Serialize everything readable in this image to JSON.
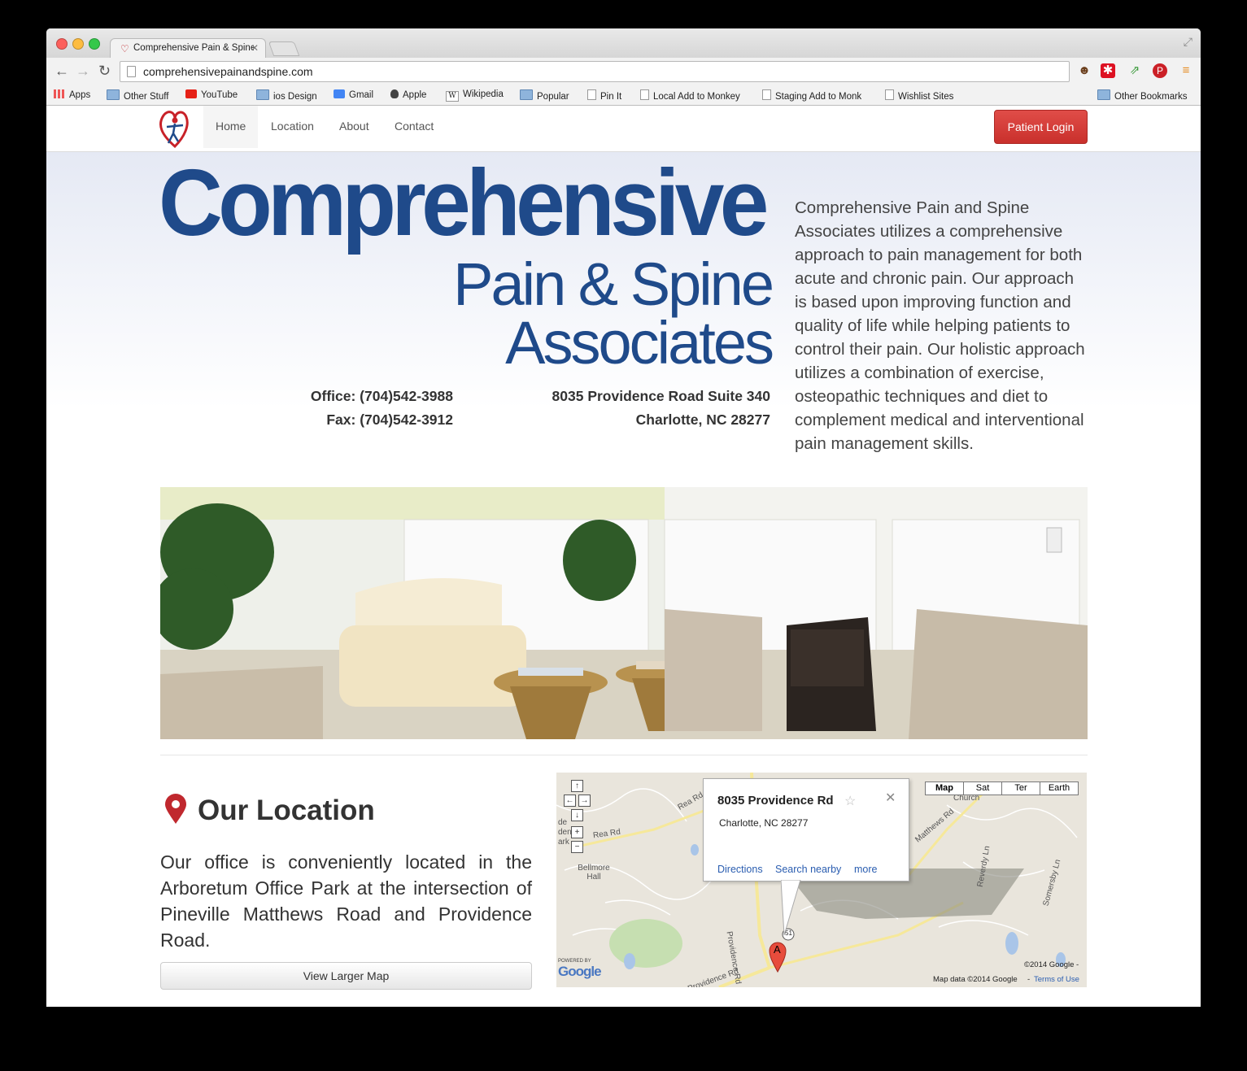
{
  "browser": {
    "tab_title": "Comprehensive Pain & Spine",
    "url": "comprehensivepainandspine.com",
    "bookmarks": [
      "Apps",
      "Other Stuff",
      "YouTube",
      "ios Design",
      "Gmail",
      "Apple",
      "Wikipedia",
      "Popular",
      "Pin It",
      "Local Add to Monkey",
      "Staging Add to Monk",
      "Wishlist Sites"
    ],
    "other_bookmarks": "Other Bookmarks"
  },
  "nav": {
    "links": [
      "Home",
      "Location",
      "About",
      "Contact"
    ],
    "login_label": "Patient Login"
  },
  "hero": {
    "brand_line1": "Comprehensive",
    "brand_line2": "Pain & Spine",
    "brand_line3": "Associates",
    "office": "Office: (704)542-3988",
    "fax": "Fax: (704)542-3912",
    "address1": "8035 Providence Road Suite 340",
    "address2": "Charlotte, NC 28277",
    "intro": "Comprehensive Pain and Spine Associates utilizes a comprehensive approach to pain management for both acute and chronic pain. Our approach is based upon improving function and quality of life while helping patients to control their pain. Our holistic approach utilizes a combination of exercise, osteopathic techniques and diet to complement medical and interventional pain management skills."
  },
  "location": {
    "title": "Our Location",
    "text": "Our office is conveniently located in the Arboretum Office Park at the intersection of Pineville Matthews Road and Providence Road.",
    "button": "View Larger Map"
  },
  "map": {
    "types": [
      "Map",
      "Sat",
      "Ter",
      "Earth"
    ],
    "bubble_title": "8035 Providence Rd",
    "bubble_address": "Charlotte, NC 28277",
    "links": [
      "Directions",
      "Search nearby",
      "more"
    ],
    "marker": "A",
    "copyright": "©2014 Google -",
    "map_data": "Map data ©2014 Google",
    "terms": "Terms of Use",
    "labels": [
      "Rea Rd",
      "Rea Rd",
      "Bellmore Hall",
      "Providence Rd",
      "Church",
      "Matthews Rd",
      "Reverdy Ln",
      "Somersby Ln",
      "51",
      "de",
      "den",
      "ark",
      "Providence Rd"
    ],
    "powered_by": "POWERED BY",
    "google": "Google"
  },
  "colors": {
    "brand_blue": "#1f4a8a",
    "login_red": "#d64541",
    "link_blue": "#2a5db0"
  }
}
